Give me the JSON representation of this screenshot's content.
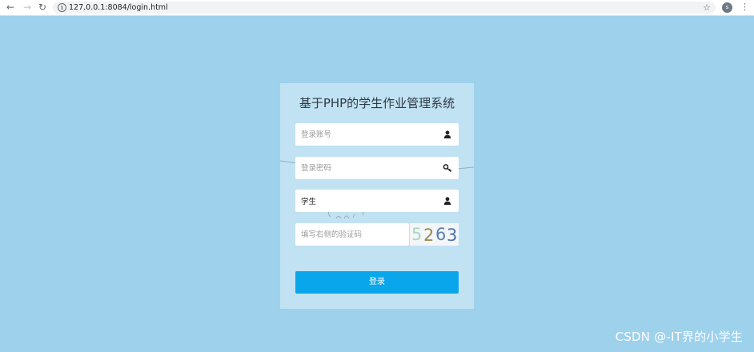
{
  "browser": {
    "url": "127.0.0.1:8084/login.html",
    "avatar_letter": "s"
  },
  "login": {
    "title": "基于PHP的学生作业管理系统",
    "username_placeholder": "登录账号",
    "password_placeholder": "登录密码",
    "role_value": "学生",
    "captcha_placeholder": "填写右侧的验证码",
    "captcha_text": "5263",
    "login_label": "登录"
  },
  "watermark": "CSDN @-IT界的小学生",
  "colors": {
    "page_background": "#9dd1ec",
    "login_button": "#0aa6eb",
    "captcha_digits": [
      "#a9d6c2",
      "#9c8a4b",
      "#5c7fb3",
      "#4d70ad"
    ]
  },
  "icons": [
    "back-arrow",
    "forward-arrow",
    "reload",
    "info",
    "star",
    "user",
    "key",
    "kebab-menu"
  ]
}
